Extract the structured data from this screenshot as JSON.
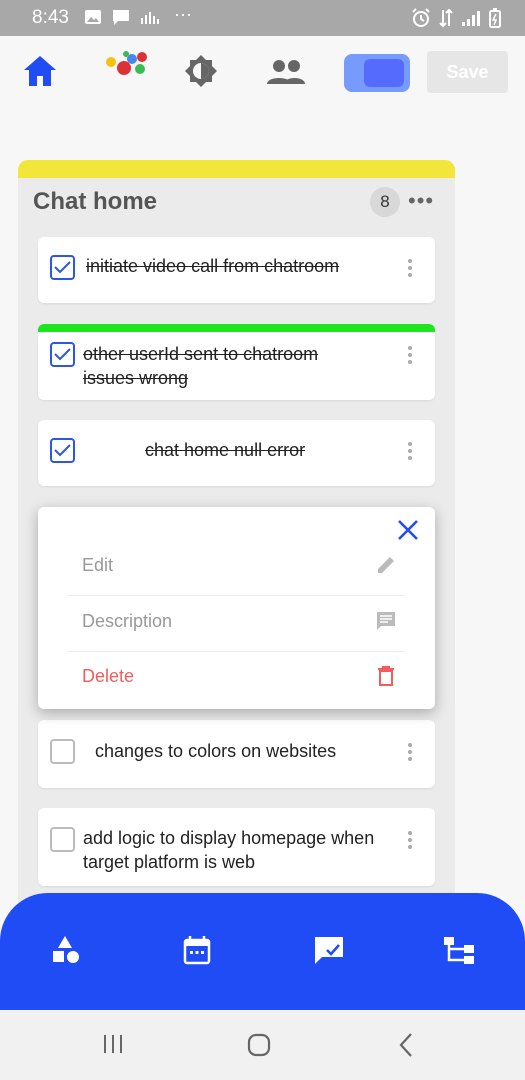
{
  "status_bar": {
    "time": "8:43",
    "more": "···"
  },
  "toolbar": {
    "save_label": "Save"
  },
  "board": {
    "title": "Chat home",
    "count": "8"
  },
  "tasks": [
    {
      "label": "initiate video call from chatroom",
      "checked": true
    },
    {
      "label": "other userId sent to chatroom issues wrong",
      "checked": true
    },
    {
      "label": "chat home null error",
      "checked": true
    },
    {
      "label": "changes to colors on websites",
      "checked": false
    },
    {
      "label": "add logic to display homepage when target platform is web",
      "checked": false
    }
  ],
  "context_menu": {
    "items": [
      {
        "label": "Edit",
        "icon": "pencil-icon"
      },
      {
        "label": "Description",
        "icon": "comment-icon"
      },
      {
        "label": "Delete",
        "icon": "trash-icon"
      }
    ]
  },
  "bottom_nav": {
    "items": [
      "shapes-icon",
      "calendar-icon",
      "chat-check-icon",
      "tree-icon"
    ]
  },
  "colors": {
    "accent": "#1f4cf5",
    "delete": "#f25c5c",
    "stripe_yellow": "#f2e63b",
    "stripe_green": "#1ee61e"
  }
}
